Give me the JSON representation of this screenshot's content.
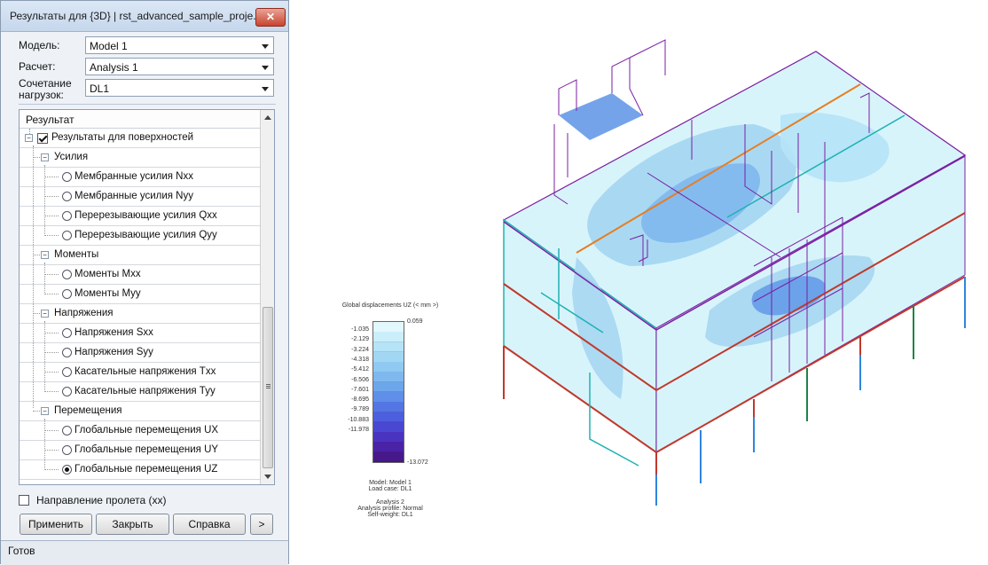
{
  "dialog": {
    "title": "Результаты для {3D} | rst_advanced_sample_proje...",
    "close_glyph": "✕",
    "fields": {
      "model": {
        "label": "Модель:",
        "value": "Model 1"
      },
      "analysis": {
        "label": "Расчет:",
        "value": "Analysis 1"
      },
      "combo": {
        "label_l1": "Сочетание",
        "label_l2": "нагрузок:",
        "value": "DL1"
      }
    },
    "tree": {
      "header": "Результат",
      "root": "Результаты для поверхностей",
      "groups": {
        "forces": {
          "label": "Усилия",
          "items": [
            "Мембранные усилия Nxx",
            "Мембранные усилия Nyy",
            "Перерезывающие усилия Qxx",
            "Перерезывающие усилия Qyy"
          ]
        },
        "moments": {
          "label": "Моменты",
          "items": [
            "Моменты Mxx",
            "Моменты Myy"
          ]
        },
        "stresses": {
          "label": "Напряжения",
          "items": [
            "Напряжения Sxx",
            "Напряжения Syy",
            "Касательные напряжения Txx",
            "Касательные напряжения Tyy"
          ]
        },
        "displacements": {
          "label": "Перемещения",
          "items": [
            "Глобальные перемещения UX",
            "Глобальные перемещения UY",
            "Глобальные перемещения UZ"
          ]
        }
      },
      "selected": "Глобальные перемещения UZ"
    },
    "span_direction": {
      "label": "Направление пролета (xx)",
      "checked": false
    },
    "buttons": {
      "apply": "Применить",
      "close": "Закрыть",
      "help": "Справка",
      "more": ">"
    },
    "status": "Готов"
  },
  "legend": {
    "title": "Global displacements UZ (< mm >)",
    "max": "0.059",
    "min": "-13.072",
    "ticks": [
      "-1.035",
      "-2.129",
      "-3.224",
      "-4.318",
      "-5.412",
      "-6.506",
      "-7.601",
      "-8.695",
      "-9.789",
      "-10.883",
      "-11.978"
    ],
    "colors": [
      "#e2f8fd",
      "#caeefa",
      "#b5e3f7",
      "#a2d7f4",
      "#90c9f1",
      "#7fb8ee",
      "#6ea6ec",
      "#5f8fe9",
      "#5476e4",
      "#4d5ede",
      "#4a47d2",
      "#4a33bf",
      "#4a22a6",
      "#461889"
    ],
    "info": {
      "model": "Model: Model 1",
      "load_case": "Load case: DL1",
      "analysis": "Analysis 2",
      "profile": "Analysis profile: Normal",
      "self_weight": "Self-weight: DL1"
    }
  },
  "colors": {
    "frame": "#7a1fa2",
    "slab": "#d8f4fb",
    "slab_mid": "#a6d7f1",
    "slab_deep": "#5d93e6",
    "wall_edge": "#1fb2b2",
    "beam": "#c0392b",
    "beam_alt": "#e67e22",
    "column_blue": "#2e86de",
    "column_green": "#1e8449",
    "column_red": "#c0392b"
  }
}
